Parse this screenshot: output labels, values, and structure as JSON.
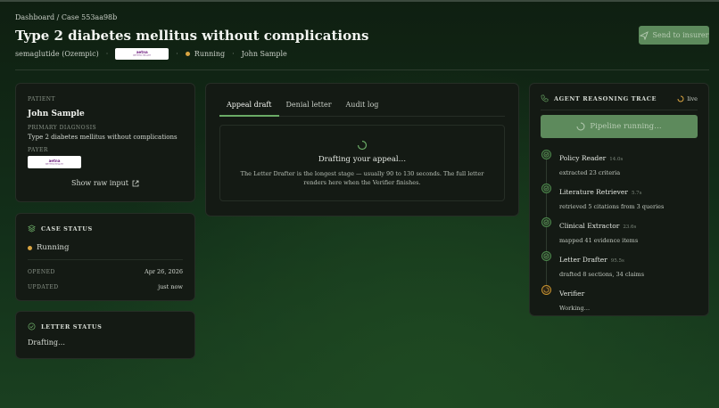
{
  "breadcrumb": "Dashboard / Case 553aa98b",
  "page_title": "Type 2 diabetes mellitus without complications",
  "meta": {
    "drug": "semaglutide (Ozempic)",
    "payer_logo_line1": "aetna",
    "payer_logo_line2": "BETTER HEALTH",
    "status": "Running",
    "patient": "John Sample"
  },
  "send_button_label": "Send to insurer",
  "patient_card": {
    "label": "PATIENT",
    "name": "John Sample",
    "diagnosis_label": "PRIMARY DIAGNOSIS",
    "diagnosis": "Type 2 diabetes mellitus without complications",
    "payer_label": "PAYER",
    "show_raw": "Show raw input"
  },
  "case_status": {
    "title": "CASE STATUS",
    "status": "Running",
    "opened_label": "OPENED",
    "opened": "Apr 26, 2026",
    "updated_label": "UPDATED",
    "updated": "just now"
  },
  "letter_status": {
    "title": "LETTER STATUS",
    "text": "Drafting…"
  },
  "tabs": [
    "Appeal draft",
    "Denial letter",
    "Audit log"
  ],
  "draft": {
    "title": "Drafting your appeal…",
    "description": "The Letter Drafter is the longest stage — usually 90 to 130 seconds. The full letter renders here when the Verifier finishes."
  },
  "trace": {
    "title": "AGENT REASONING TRACE",
    "live": "live",
    "pipeline_button": "Pipeline running…",
    "steps": [
      {
        "name": "Policy Reader",
        "time": "14.0s",
        "desc": "extracted 23 criteria",
        "state": "done"
      },
      {
        "name": "Literature Retriever",
        "time": "5.7s",
        "desc": "retrieved 5 citations from 3 queries",
        "state": "done"
      },
      {
        "name": "Clinical Extractor",
        "time": "23.6s",
        "desc": "mapped 41 evidence items",
        "state": "done"
      },
      {
        "name": "Letter Drafter",
        "time": "95.5s",
        "desc": "drafted 8 sections, 34 claims",
        "state": "done"
      },
      {
        "name": "Verifier",
        "time": "",
        "desc": "Working…",
        "state": "pending"
      }
    ]
  },
  "colors": {
    "accent": "#5d8a5c",
    "running": "#d9a441",
    "done": "#4e8a4d"
  }
}
